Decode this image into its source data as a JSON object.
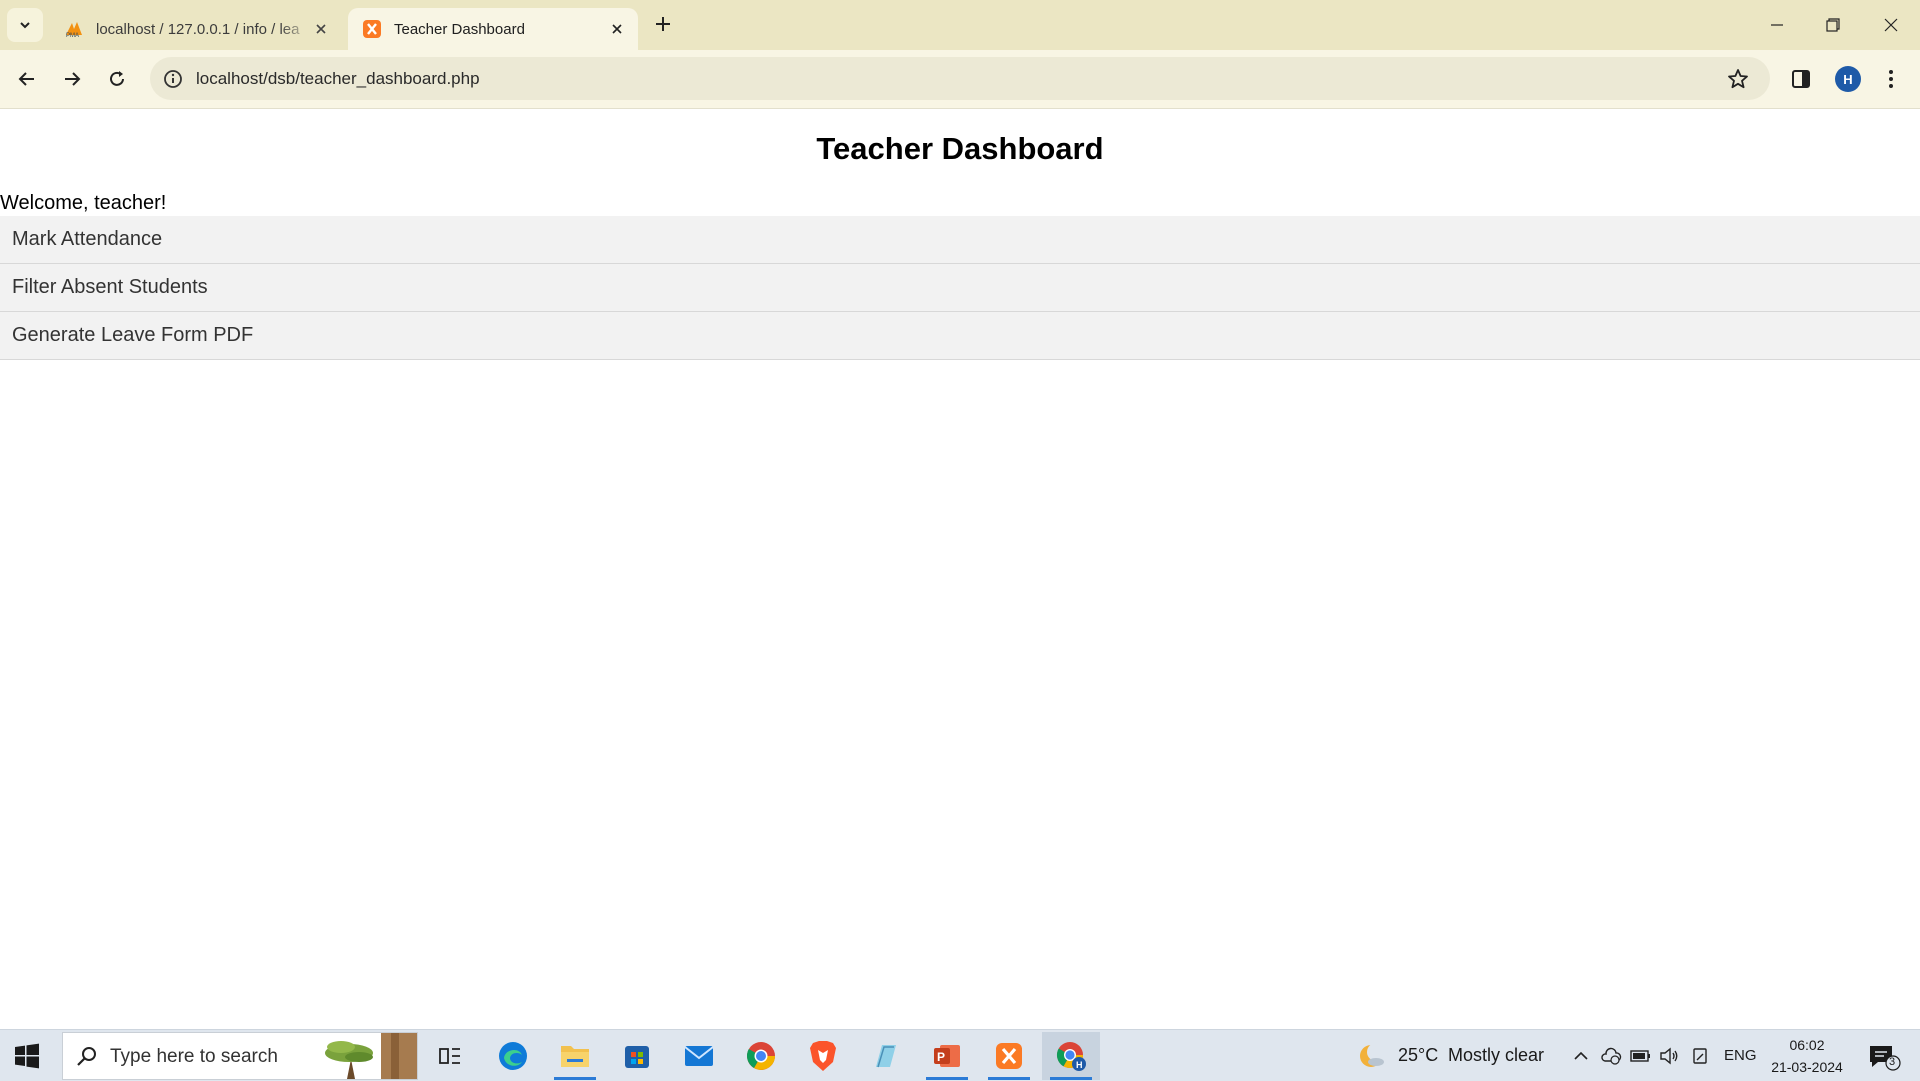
{
  "browser": {
    "tabs": [
      {
        "title": "localhost / 127.0.0.1 / info / lea",
        "icon": "phpmyadmin-icon",
        "active": false
      },
      {
        "title": "Teacher Dashboard",
        "icon": "xampp-icon",
        "active": true
      }
    ],
    "url": "localhost/dsb/teacher_dashboard.php",
    "profile_initial": "H"
  },
  "page": {
    "title": "Teacher Dashboard",
    "welcome": "Welcome, teacher!",
    "menu": [
      {
        "label": "Mark Attendance"
      },
      {
        "label": "Filter Absent Students"
      },
      {
        "label": "Generate Leave Form PDF"
      }
    ]
  },
  "taskbar": {
    "search_placeholder": "Type here to search",
    "apps": [
      "task-view",
      "edge",
      "file-explorer",
      "microsoft-store",
      "mail",
      "chrome",
      "brave",
      "notepad",
      "powerpoint",
      "xampp",
      "chrome-profile"
    ],
    "weather": {
      "temp": "25°C",
      "condition": "Mostly clear"
    },
    "language": "ENG",
    "time": "06:02",
    "date": "21-03-2024",
    "notification_count": "3"
  },
  "colors": {
    "tabbar": "#ebe6c3",
    "toolbar": "#f8f5e4",
    "omnibox": "#ece9d5",
    "menu_bg": "#f2f2f2",
    "taskbar": "#dfe6ee",
    "accent": "#2c7bd6"
  }
}
